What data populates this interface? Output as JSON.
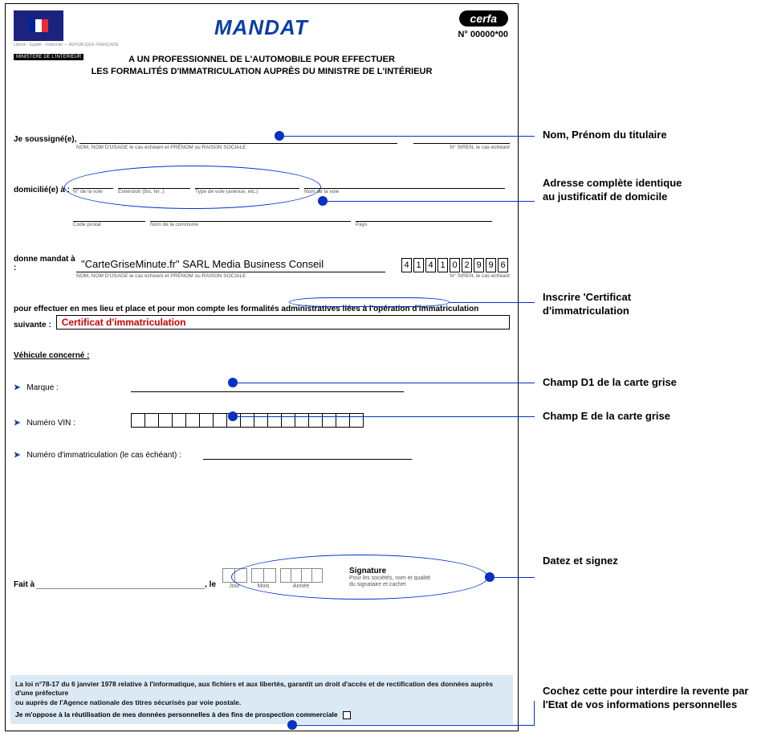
{
  "header": {
    "logo_caption": "Liberté · Égalité · Fraternité — RÉPUBLIQUE FRANÇAISE",
    "ministry": "MINISTÈRE DE L'INTÉRIEUR",
    "title": "MANDAT",
    "cerfa": "cerfa",
    "form_number": "N° 00000*00",
    "subtitle_line1": "A UN PROFESSIONNEL DE L'AUTOMOBILE POUR EFFECTUER",
    "subtitle_line2": "LES FORMALITÉS D'IMMATRICULATION AUPRÈS DU MINISTRE DE L'INTÉRIEUR"
  },
  "s1": {
    "label": "Je soussigné(e),",
    "sub_nom": "NOM, NOM D'USAGE le cas échéant et PRÉNOM ou RAISON SOCIALE",
    "sub_siren": "N° SIREN, le cas échéant"
  },
  "s2": {
    "label": "domicilié(e) à :",
    "cap_no": "N° de la voie",
    "cap_ext": "Extension (bis, ter..)",
    "cap_typ": "Type de voie (avenue, etc.)",
    "cap_nomvoie": "Nom de la voie",
    "cap_cp": "Code postal",
    "cap_com": "Nom de la commune",
    "cap_pays": "Pays"
  },
  "s3": {
    "label": "donne mandat à :",
    "company": "\"CarteGriseMinute.fr\" SARL Media Business Conseil",
    "sub_nom": "NOM, NOM D'USAGE le cas échéant et PRÉNOM ou RAISON SOCIALE",
    "sub_siren": "N° SIREN, le cas échéant",
    "siren": [
      "4",
      "1",
      "4",
      "1",
      "0",
      "2",
      "9",
      "9",
      "6"
    ]
  },
  "s4": {
    "line1": "pour effectuer en mes lieu et place et pour mon compte les formalités administratives liées à l'opération d'immatriculation",
    "line2_label": "suivante :",
    "value": "Certificat d'immatriculation"
  },
  "s5": {
    "heading": "Véhicule concerné :",
    "marque_label": "Marque :",
    "vin_label": "Numéro VIN :",
    "immat_label": "Numéro d'immatriculation (le cas échéant) :",
    "vin_slots": 17
  },
  "s6": {
    "fait": "Fait à",
    "le": ", le",
    "cap_j": "Jour",
    "cap_m": "Mois",
    "cap_a": "Année",
    "sig_title": "Signature",
    "sig_sub1": "Pour les sociétés, nom et qualité",
    "sig_sub2": "du signataire et cachet"
  },
  "foot": {
    "line1": "La loi n°78-17 du 6 janvier 1978 relative à l'informatique, aux fichiers et aux libertés, garantit un droit d'accès et de rectification des données auprès d'une préfecture",
    "line2": "ou auprès de l'Agence nationale des titres sécurisés par voie postale.",
    "check_label": "Je m'oppose à la réutilisation de mes données personnelles à des fins de prospection commerciale"
  },
  "annotations": {
    "a1": "Nom, Prénom du titulaire",
    "a2a": "Adresse complète identique",
    "a2b": "au justificatif de domicile",
    "a3a": "Inscrire 'Certificat",
    "a3b": "d'immatriculation",
    "a4": "Champ D1 de la carte grise",
    "a5": "Champ E de la carte grise",
    "a6": "Datez et signez",
    "a7a": "Cochez cette pour interdire la revente par",
    "a7b": "l'Etat de vos informations personnelles"
  }
}
